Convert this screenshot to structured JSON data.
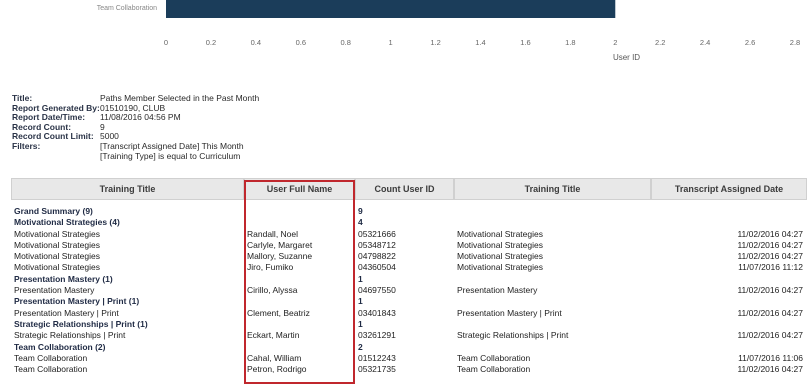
{
  "chart_data": {
    "type": "bar",
    "orientation": "horizontal",
    "categories": [
      "Team Collaboration"
    ],
    "values": [
      2
    ],
    "xlabel": "User ID",
    "xlim": [
      0,
      2.8
    ],
    "ticks": [
      "0",
      "0.2",
      "0.4",
      "0.6",
      "0.8",
      "1",
      "1.2",
      "1.4",
      "1.6",
      "1.8",
      "2",
      "2.2",
      "2.4",
      "2.6",
      "2.8"
    ],
    "bar_color": "#1b3d5a"
  },
  "meta": {
    "title_label": "Title:",
    "title_value": "Paths Member Selected in the Past Month",
    "generated_label": "Report Generated By:",
    "generated_value": "01510190, CLUB",
    "datetime_label": "Report Date/Time:",
    "datetime_value": "11/08/2016 04:56 PM",
    "count_label": "Record Count:",
    "count_value": "9",
    "limit_label": "Record Count Limit:",
    "limit_value": "5000",
    "filters_label": "Filters:",
    "filter1": "[Transcript Assigned Date] This Month",
    "filter2": "[Training Type] is equal to Curriculum"
  },
  "table": {
    "headers": [
      "Training Title",
      "User Full Name",
      "Count User ID",
      "Training Title",
      "Transcript Assigned Date"
    ],
    "rows": [
      {
        "bold": true,
        "cells": [
          "Grand Summary (9)",
          "",
          "9",
          "",
          ""
        ]
      },
      {
        "bold": true,
        "cells": [
          "Motivational Strategies (4)",
          "",
          "4",
          "",
          ""
        ]
      },
      {
        "bold": false,
        "cells": [
          "Motivational Strategies",
          "Randall, Noel",
          "05321666",
          "Motivational Strategies",
          "11/02/2016 04:27"
        ]
      },
      {
        "bold": false,
        "cells": [
          "Motivational Strategies",
          "Carlyle, Margaret",
          "05348712",
          "Motivational Strategies",
          "11/02/2016 04:27"
        ]
      },
      {
        "bold": false,
        "cells": [
          "Motivational Strategies",
          "Mallory, Suzanne",
          "04798822",
          "Motivational Strategies",
          "11/02/2016 04:27"
        ]
      },
      {
        "bold": false,
        "cells": [
          "Motivational Strategies",
          "Jiro, Fumiko",
          "04360504",
          "Motivational Strategies",
          "11/07/2016 11:12"
        ]
      },
      {
        "bold": true,
        "cells": [
          "Presentation Mastery (1)",
          "",
          "1",
          "",
          ""
        ]
      },
      {
        "bold": false,
        "cells": [
          "Presentation Mastery",
          "Cirillo, Alyssa",
          "04697550",
          "Presentation Mastery",
          "11/02/2016 04:27"
        ]
      },
      {
        "bold": true,
        "cells": [
          "Presentation Mastery | Print (1)",
          "",
          "1",
          "",
          ""
        ]
      },
      {
        "bold": false,
        "cells": [
          "Presentation Mastery | Print",
          "Clement, Beatriz",
          "03401843",
          "Presentation Mastery | Print",
          "11/02/2016 04:27"
        ]
      },
      {
        "bold": true,
        "cells": [
          "Strategic Relationships | Print (1)",
          "",
          "1",
          "",
          ""
        ]
      },
      {
        "bold": false,
        "cells": [
          "Strategic Relationships | Print",
          "Eckart, Martin",
          "03261291",
          "Strategic Relationships | Print",
          "11/02/2016 04:27"
        ]
      },
      {
        "bold": true,
        "cells": [
          "Team Collaboration (2)",
          "",
          "2",
          "",
          ""
        ]
      },
      {
        "bold": false,
        "cells": [
          "Team Collaboration",
          "Cahal, William",
          "01512243",
          "Team Collaboration",
          "11/07/2016 11:06"
        ]
      },
      {
        "bold": false,
        "cells": [
          "Team Collaboration",
          "Petron, Rodrigo",
          "05321735",
          "Team Collaboration",
          "11/02/2016 04:27"
        ]
      }
    ]
  }
}
